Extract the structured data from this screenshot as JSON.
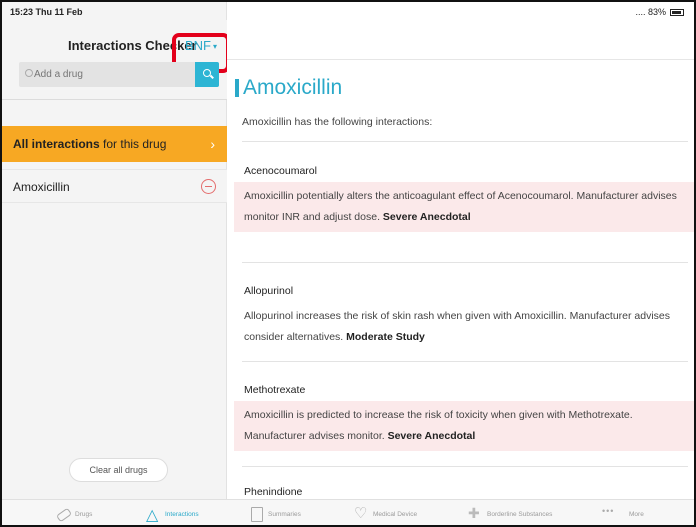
{
  "status": {
    "time_date": "15:23 Thu 11 Feb",
    "indicators": "....  83%"
  },
  "sidebar": {
    "title": "Interactions Checker",
    "source": "BNF",
    "search_placeholder": "Add a drug",
    "all_interactions_bold": "All interactions",
    "all_interactions_rest": " for this drug",
    "drugs": [
      "Amoxicillin"
    ],
    "clear_label": "Clear all drugs"
  },
  "main": {
    "drug_title": "Amoxicillin",
    "intro": "Amoxicillin has the following interactions:",
    "interactions": [
      {
        "drug": "Acenocoumarol",
        "text": "Amoxicillin potentially alters the anticoagulant effect of Acenocoumarol. Manufacturer advises monitor INR and adjust dose.",
        "severity": "Severe Anecdotal"
      },
      {
        "drug": "Allopurinol",
        "text": "Allopurinol increases the risk of skin rash when given with Amoxicillin. Manufacturer advises consider alternatives.",
        "severity": "Moderate Study"
      },
      {
        "drug": "Methotrexate",
        "text": "Amoxicillin is predicted to increase the risk of toxicity when given with Methotrexate. Manufacturer advises monitor.",
        "severity": "Severe Anecdotal"
      },
      {
        "drug": "Phenindione",
        "text": "",
        "severity": ""
      }
    ]
  },
  "tabs": [
    {
      "label": "Drugs",
      "icon": "pill-icon"
    },
    {
      "label": "Interactions",
      "icon": "network-icon"
    },
    {
      "label": "Summaries",
      "icon": "document-icon"
    },
    {
      "label": "Medical Device",
      "icon": "heart-icon"
    },
    {
      "label": "Borderline Substances",
      "icon": "cross-icon"
    },
    {
      "label": "More",
      "icon": "more-dots-icon"
    }
  ],
  "colors": {
    "accent": "#2aa9c9",
    "orange": "#f7a823",
    "severe_bg": "#fbe9ea",
    "highlight": "#e3001b"
  }
}
